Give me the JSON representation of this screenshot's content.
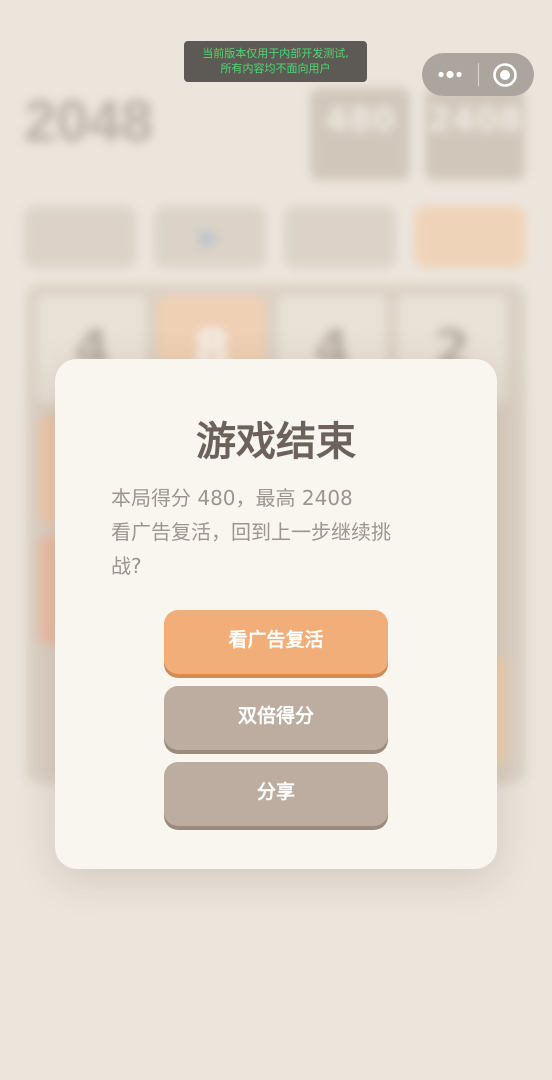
{
  "background_game": {
    "title": "2048",
    "subtitle": "",
    "score_label": "",
    "score_value": "480",
    "best_label": "",
    "best_value": "2408",
    "buttons": [
      "",
      "▶",
      "",
      ""
    ],
    "tiles": [
      "4",
      "8",
      "4",
      "2",
      "",
      "",
      "",
      "",
      "",
      "",
      "",
      "",
      "",
      "",
      "",
      ""
    ]
  },
  "dev_banner": {
    "line1": "当前版本仅用于内部开发测试,",
    "line2": "所有内容均不面向用户"
  },
  "capsule": {
    "more_icon": "more-dots-icon",
    "close_icon": "target-circle-icon"
  },
  "dialog": {
    "title": "游戏结束",
    "message_line1": "本局得分 480，最高 2408",
    "message_line2": "看广告复活，回到上一步继续挑",
    "message_line3": "战?",
    "buttons": {
      "revive": "看广告复活",
      "double": "双倍得分",
      "share": "分享"
    }
  },
  "colors": {
    "accent_orange": "#f1ae78",
    "button_gray": "#bcada0",
    "title_text": "#6c625a",
    "dev_text": "#4fd870"
  }
}
